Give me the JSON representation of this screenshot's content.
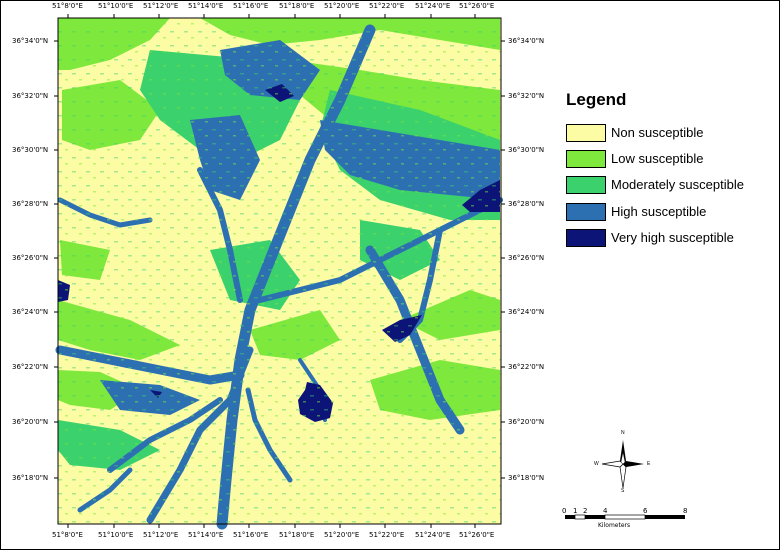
{
  "map": {
    "lon_labels": [
      "51°8'0\"E",
      "51°10'0\"E",
      "51°12'0\"E",
      "51°14'0\"E",
      "51°16'0\"E",
      "51°18'0\"E",
      "51°20'0\"E",
      "51°22'0\"E",
      "51°24'0\"E",
      "51°26'0\"E"
    ],
    "lat_labels": [
      "36°34'0\"N",
      "36°32'0\"N",
      "36°30'0\"N",
      "36°28'0\"N",
      "36°26'0\"N",
      "36°24'0\"N",
      "36°22'0\"N",
      "36°20'0\"N",
      "36°18'0\"N"
    ]
  },
  "legend": {
    "title": "Legend",
    "items": [
      {
        "label": "Non susceptible",
        "color": "#fcfca4"
      },
      {
        "label": "Low susceptible",
        "color": "#7ee83c"
      },
      {
        "label": "Moderately susceptible",
        "color": "#3bd16c"
      },
      {
        "label": "High susceptible",
        "color": "#2d70b2"
      },
      {
        "label": "Very high susceptible",
        "color": "#0d1478"
      }
    ]
  },
  "north_arrow": {
    "n": "N",
    "s": "S",
    "e": "E",
    "w": "W"
  },
  "scale": {
    "numbers": [
      "0",
      "1",
      "2",
      "4",
      "6",
      "8"
    ],
    "unit": "Kilometers"
  }
}
